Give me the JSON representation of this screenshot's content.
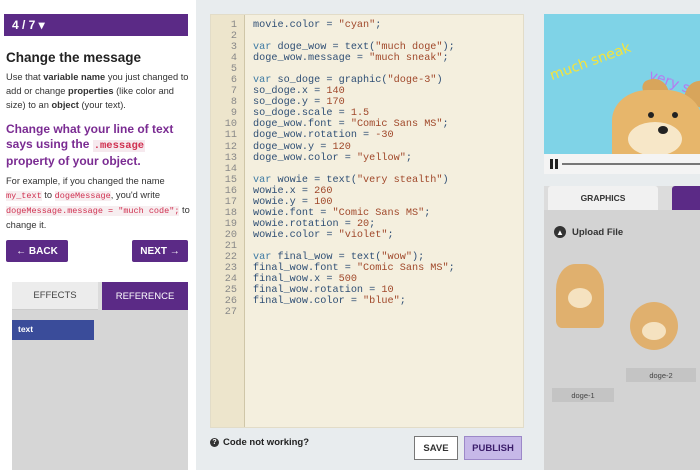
{
  "lesson": {
    "step": "4 / 7 ▾",
    "title": "Change the message",
    "intro": {
      "t1": "Use that ",
      "b1": "variable name",
      "t2": " you just changed to add or change ",
      "b2": "properties",
      "t3": " (like color and size) to an ",
      "b3": "object",
      "t4": " (your text)."
    },
    "callout": {
      "t1": "Change what your line of text says using the ",
      "code": ".message",
      "t2": " property of your object."
    },
    "example": {
      "t1": "For example, if you changed the name ",
      "code1": "my_text",
      "t2": " to ",
      "code2": "dogeMessage",
      "t3": ", you'd write ",
      "code3": "dogeMessage.message = \"much code\";",
      "t4": " to change it."
    },
    "back_label": "← BACK",
    "next_label": "NEXT →"
  },
  "reference": {
    "tabs": [
      "EFFECTS",
      "REFERENCE"
    ],
    "items": [
      "text"
    ]
  },
  "editor": {
    "lines": [
      "movie.color = \"cyan\";",
      "",
      "var doge_wow = text(\"much doge\");",
      "doge_wow.message = \"much sneak\";",
      "",
      "var so_doge = graphic(\"doge-3\")",
      "so_doge.x = 140",
      "so_doge.y = 170",
      "so_doge.scale = 1.5",
      "doge_wow.font = \"Comic Sans MS\";",
      "doge_wow.rotation = -30",
      "doge_wow.y = 120",
      "doge_wow.color = \"yellow\";",
      "",
      "var wowie = text(\"very stealth\")",
      "wowie.x = 260",
      "wowie.y = 100",
      "wowie.font = \"Comic Sans MS\";",
      "wowie.rotation = 20;",
      "wowie.color = \"violet\";",
      "",
      "var final_wow = text(\"wow\");",
      "final_wow.font = \"Comic Sans MS\";",
      "final_wow.x = 500",
      "final_wow.rotation = 10",
      "final_wow.color = \"blue\";",
      ""
    ],
    "help_label": "Code not working?",
    "save_label": "SAVE",
    "publish_label": "PUBLISH"
  },
  "preview": {
    "much": "much sneak",
    "very": "very s"
  },
  "graphics": {
    "tab_label": "GRAPHICS",
    "upload_label": "Upload File",
    "thumbs": [
      "doge-1",
      "doge-2"
    ]
  }
}
